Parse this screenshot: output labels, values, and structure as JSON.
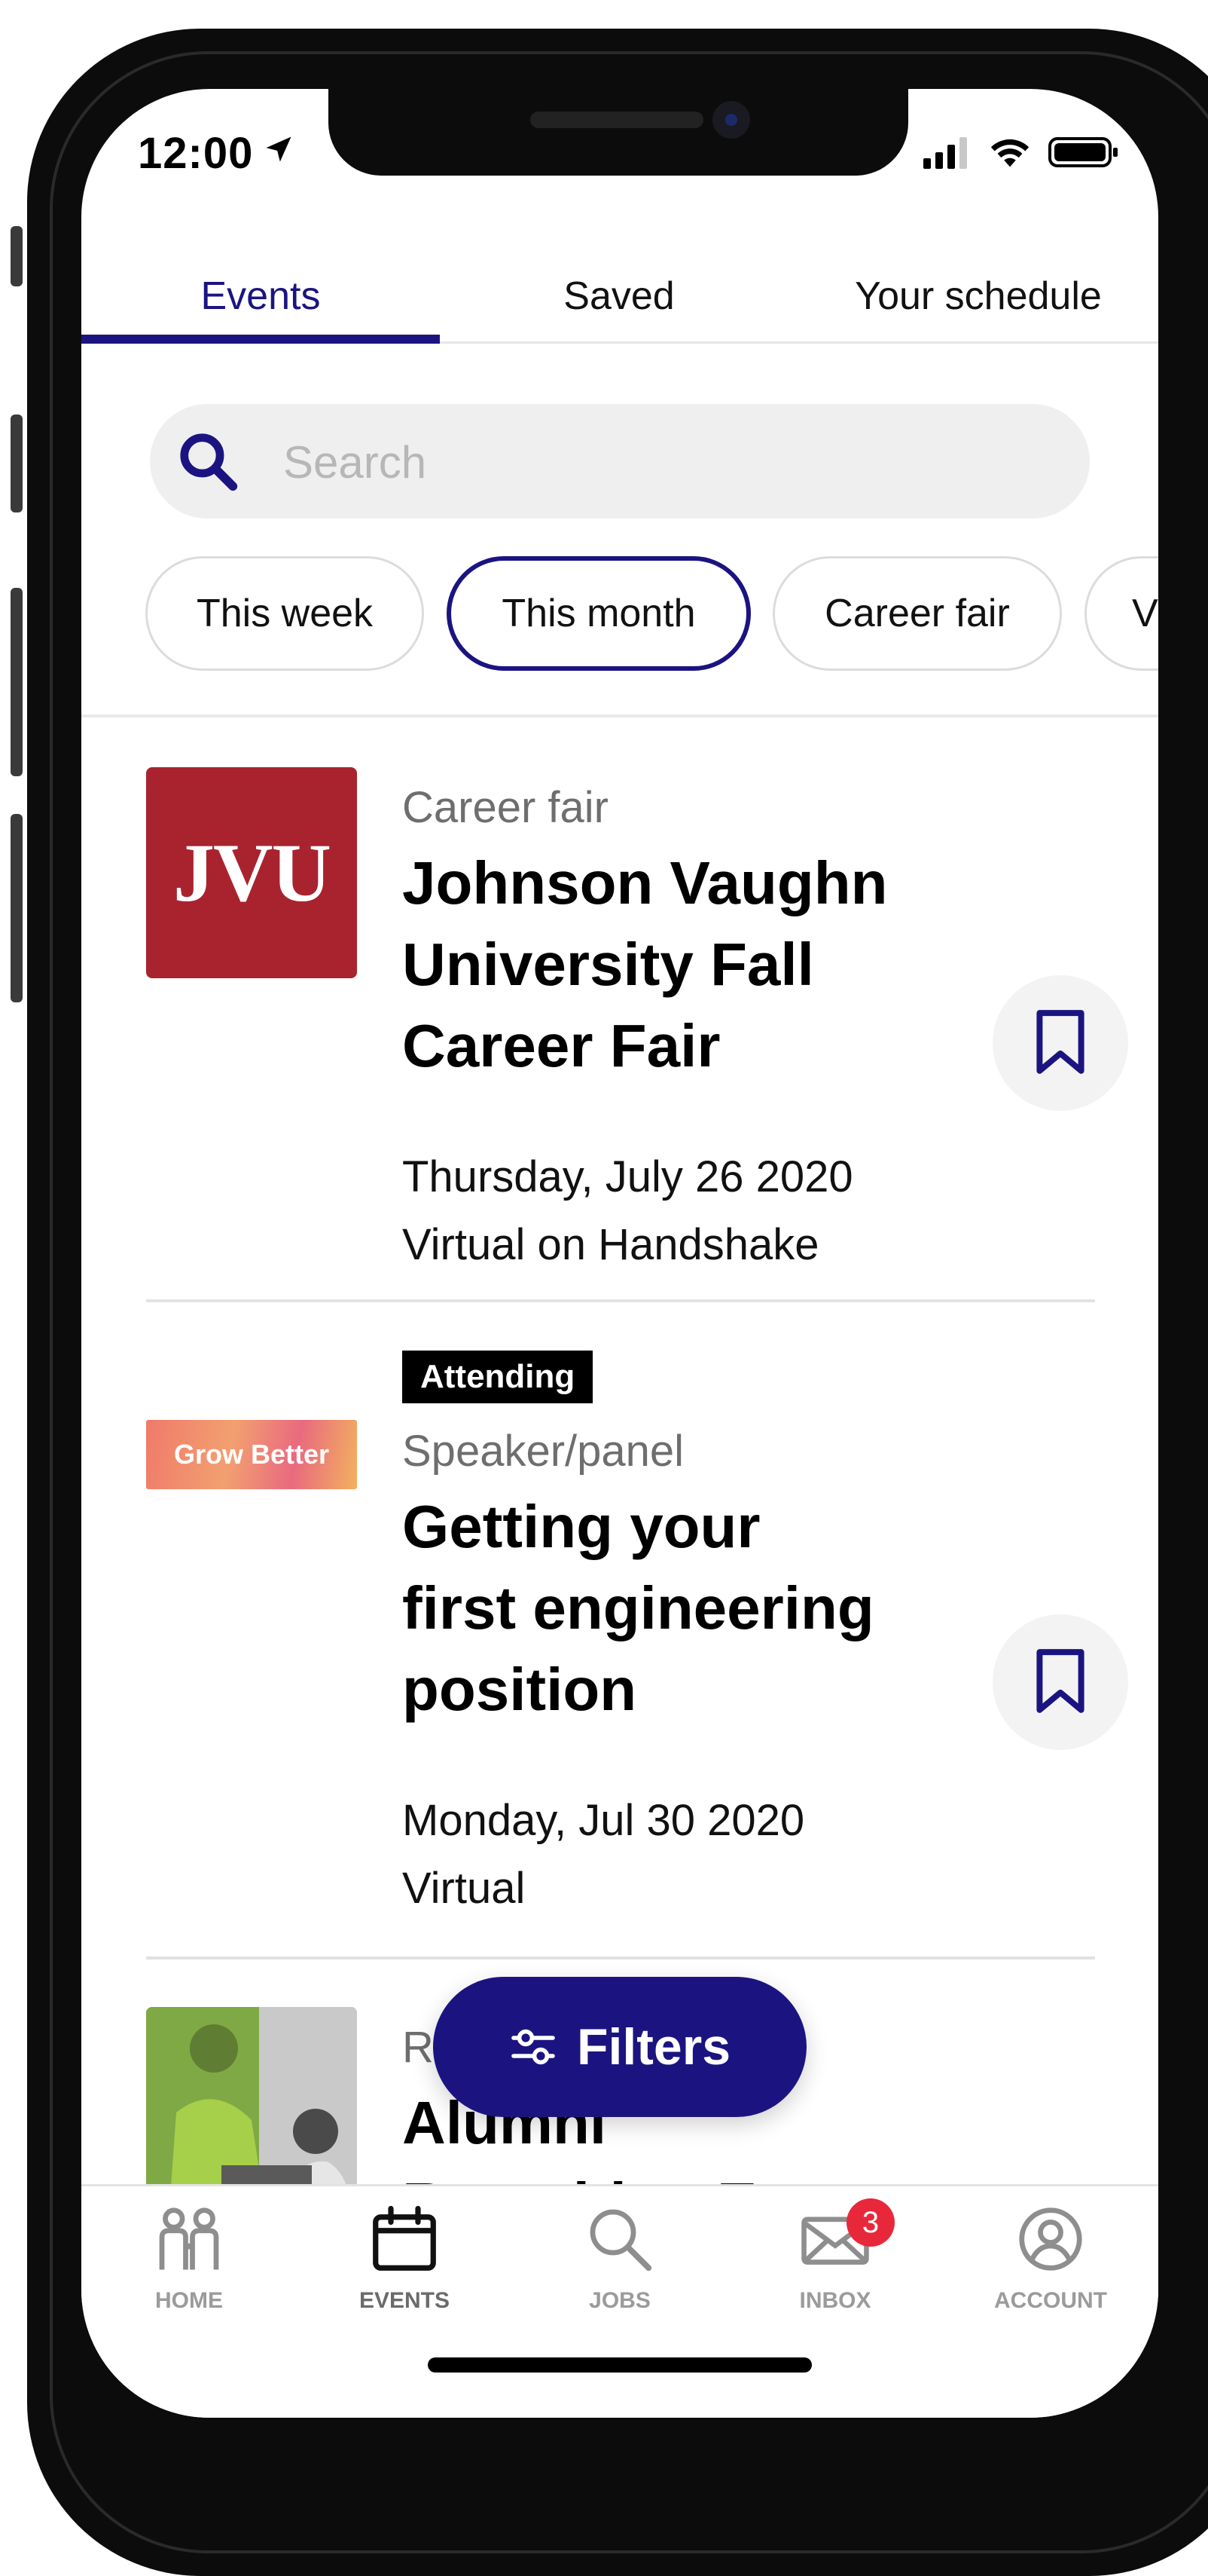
{
  "status_bar": {
    "time": "12:00"
  },
  "tabs": [
    {
      "label": "Events",
      "active": true
    },
    {
      "label": "Saved",
      "active": false
    },
    {
      "label": "Your schedule",
      "active": false
    }
  ],
  "search": {
    "placeholder": "Search",
    "value": ""
  },
  "chips": [
    {
      "label": "This week",
      "selected": false
    },
    {
      "label": "This month",
      "selected": true
    },
    {
      "label": "Career fair",
      "selected": false
    },
    {
      "label": "V",
      "selected": false
    }
  ],
  "events": [
    {
      "logo_text": "JVU",
      "type": "Career fair",
      "title_lines": [
        "Johnson Vaughn",
        "University Fall",
        "Career Fair"
      ],
      "date": "Thursday, July 26 2020",
      "location": "Virtual on Handshake",
      "badge": ""
    },
    {
      "logo_text": "Grow Better",
      "type": "Speaker/panel",
      "title_lines": [
        "Getting your",
        "first engineering",
        "position"
      ],
      "date": "Monday, Jul 30 2020",
      "location": "Virtual",
      "badge": "Attending"
    },
    {
      "type": "R",
      "title_lines": [
        "Alumni",
        "Recruiting Event"
      ]
    }
  ],
  "filters": {
    "label": "Filters"
  },
  "bottom_nav": {
    "items": [
      {
        "label": "HOME",
        "icon": "people-icon"
      },
      {
        "label": "EVENTS",
        "icon": "calendar-icon",
        "active": true
      },
      {
        "label": "JOBS",
        "icon": "search-icon"
      },
      {
        "label": "INBOX",
        "icon": "mail-icon",
        "badge": "3"
      },
      {
        "label": "ACCOUNT",
        "icon": "user-icon"
      }
    ]
  },
  "colors": {
    "accent": "#1b1480",
    "jvu_red": "#a9232f",
    "badge_red": "#e8283a"
  }
}
